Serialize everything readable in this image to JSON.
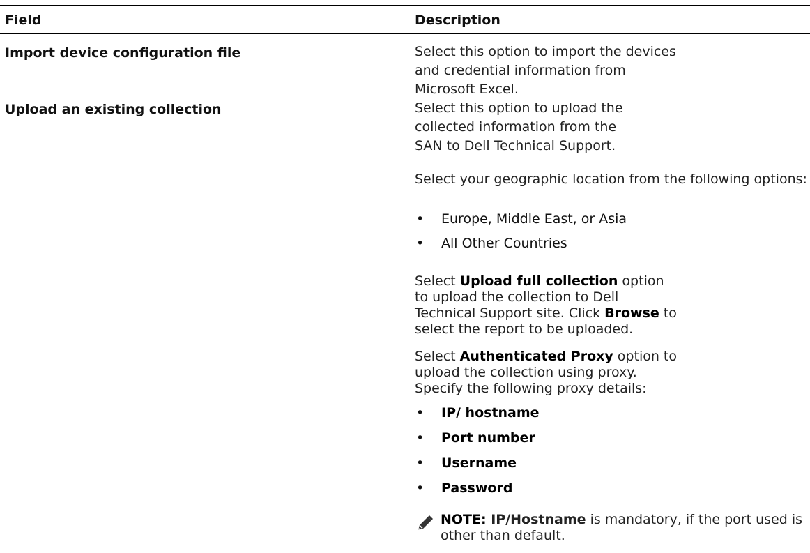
{
  "table": {
    "headers": {
      "field": "Field",
      "description": "Description"
    },
    "rows": [
      {
        "field": "Import device configuration file",
        "description": "Select this option to import the devices and credential information from Microsoft Excel."
      },
      {
        "field": "Upload an existing collection",
        "description_intro": "Select this option to upload the collected information from the SAN to Dell Technical Support.",
        "location_prompt": "Select your geographic location from the following options:",
        "locations": [
          "Europe, Middle East, or Asia",
          "All Other Countries"
        ],
        "full_collection": {
          "pre": "Select ",
          "bold": "Upload full collection",
          "mid": " option to upload the collection to Dell Technical Support site. Click ",
          "bold2": "Browse",
          "post": " to select the report to be uploaded."
        },
        "proxy": {
          "pre": "Select ",
          "bold": "Authenticated Proxy",
          "post": " option to upload the collection using proxy. Specify the following proxy details:"
        },
        "proxy_details": [
          "IP/ hostname",
          "Port number",
          "Username",
          "Password"
        ],
        "note": {
          "label": "NOTE: ",
          "bold": "IP/Hostname",
          "text": " is mandatory, if the port used is other than default."
        }
      }
    ]
  },
  "icons": {
    "note": "pencil-note-icon"
  }
}
